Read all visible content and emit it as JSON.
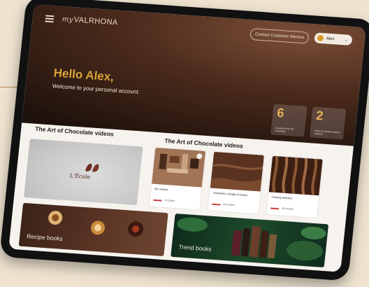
{
  "nav": {
    "brand_prefix": "my",
    "brand_name": "VALRHONA",
    "contact_label": "Contact Customer Service",
    "user_name": "Alex"
  },
  "hero": {
    "greeting": "Hello Alex,",
    "welcome": "Welcome to your personal account.",
    "stats": [
      {
        "number": "6",
        "caption": "Creations from the Essentials"
      },
      {
        "number": "2",
        "caption": "Made on Valrhona kitchen creations"
      }
    ]
  },
  "sections": {
    "left_title": "The Art of Chocolate videos",
    "right_title": "The Art of Chocolate videos"
  },
  "video_main": {
    "logo_text": "L'École"
  },
  "cards": [
    {
      "label": "My recipes",
      "count": "8 recipes"
    },
    {
      "label": "Ganaches, doughs & bases",
      "count": "44 recipes"
    },
    {
      "label": "Creamy textures",
      "count": "30 recipes"
    }
  ],
  "blocks": {
    "recipe_books": "Recipe books",
    "trend_books": "Trend books"
  },
  "colors": {
    "accent_gold": "#d9a338",
    "brand_brown": "#4a2a1c",
    "badge_red": "#d23a3a"
  }
}
